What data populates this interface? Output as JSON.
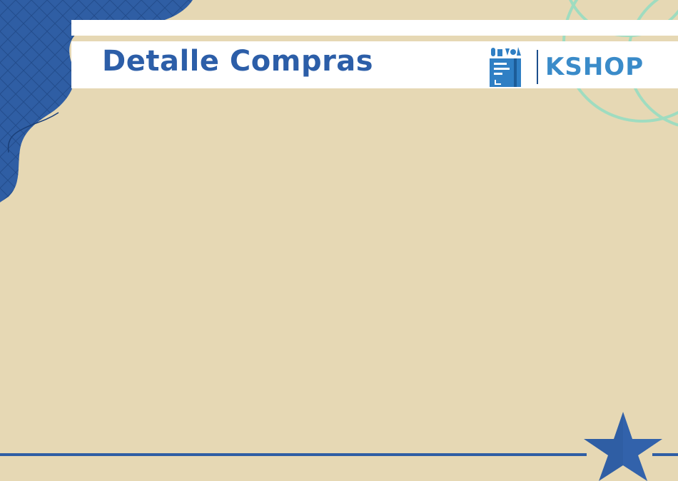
{
  "header": {
    "title": "Detalle Compras"
  },
  "logo": {
    "brand": "KSHOP",
    "icon": "shopping-bag-icon"
  },
  "decor": {
    "corner_icon": "wave-blob-icon",
    "circles_icon": "outline-circles-icon",
    "star_icon": "star-icon"
  },
  "colors": {
    "background": "#e6d8b4",
    "primary_blue": "#2c5ea8",
    "logo_blue": "#3a8bc9",
    "accent_mint": "#9fdcc0",
    "band": "#ffffff"
  }
}
